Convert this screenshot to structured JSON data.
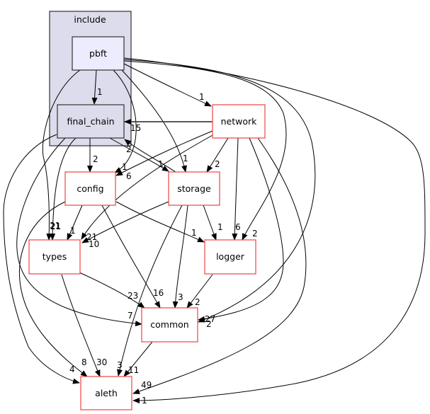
{
  "diagram": {
    "type": "directory-dependency-graph",
    "cluster": {
      "label": "include",
      "fill": "#dcdcec",
      "stroke": "#333333"
    },
    "colors": {
      "external_node_border": "#ef4444",
      "cluster_node_fill": "#dcdcec",
      "focus_node_fill": "#ececff",
      "edge": "#000000"
    },
    "nodes": {
      "pbft": "pbft",
      "final_chain": "final_chain",
      "network": "network",
      "config": "config",
      "storage": "storage",
      "types": "types",
      "logger": "logger",
      "common": "common",
      "aleth": "aleth"
    },
    "edges": [
      {
        "from": "pbft",
        "to": "final_chain",
        "label": "1"
      },
      {
        "from": "pbft",
        "to": "network",
        "label": "1"
      },
      {
        "from": "pbft",
        "to": "config",
        "label": "1"
      },
      {
        "from": "pbft",
        "to": "storage",
        "label": "1"
      },
      {
        "from": "pbft",
        "to": "types",
        "label": "21"
      },
      {
        "from": "pbft",
        "to": "logger",
        "label": "2"
      },
      {
        "from": "pbft",
        "to": "common",
        "label": "27"
      },
      {
        "from": "pbft",
        "to": "aleth",
        "label": "1"
      },
      {
        "from": "network",
        "to": "final_chain",
        "label": "15"
      },
      {
        "from": "network",
        "to": "config",
        "label": "6"
      },
      {
        "from": "network",
        "to": "storage",
        "label": "2"
      },
      {
        "from": "network",
        "to": "types",
        "label": "21"
      },
      {
        "from": "network",
        "to": "logger",
        "label": "6"
      },
      {
        "from": "network",
        "to": "common",
        "label": "2"
      },
      {
        "from": "network",
        "to": "aleth",
        "label": "49"
      },
      {
        "from": "final_chain",
        "to": "config",
        "label": "2"
      },
      {
        "from": "final_chain",
        "to": "storage",
        "label": "1"
      },
      {
        "from": "final_chain",
        "to": "types",
        "label": "21"
      },
      {
        "from": "final_chain",
        "to": "common",
        "label": "7"
      },
      {
        "from": "final_chain",
        "to": "aleth",
        "label": "4"
      },
      {
        "from": "storage",
        "to": "final_chain",
        "label": "2"
      },
      {
        "from": "storage",
        "to": "types",
        "label": "10"
      },
      {
        "from": "storage",
        "to": "logger",
        "label": "1"
      },
      {
        "from": "storage",
        "to": "common",
        "label": "3"
      },
      {
        "from": "storage",
        "to": "aleth",
        "label": "3"
      },
      {
        "from": "config",
        "to": "types",
        "label": "1"
      },
      {
        "from": "config",
        "to": "logger",
        "label": "1"
      },
      {
        "from": "config",
        "to": "common",
        "label": "16"
      },
      {
        "from": "config",
        "to": "aleth",
        "label": "8"
      },
      {
        "from": "types",
        "to": "common",
        "label": "23"
      },
      {
        "from": "types",
        "to": "aleth",
        "label": "30"
      },
      {
        "from": "logger",
        "to": "common",
        "label": "2"
      },
      {
        "from": "common",
        "to": "aleth",
        "label": "11"
      }
    ]
  }
}
